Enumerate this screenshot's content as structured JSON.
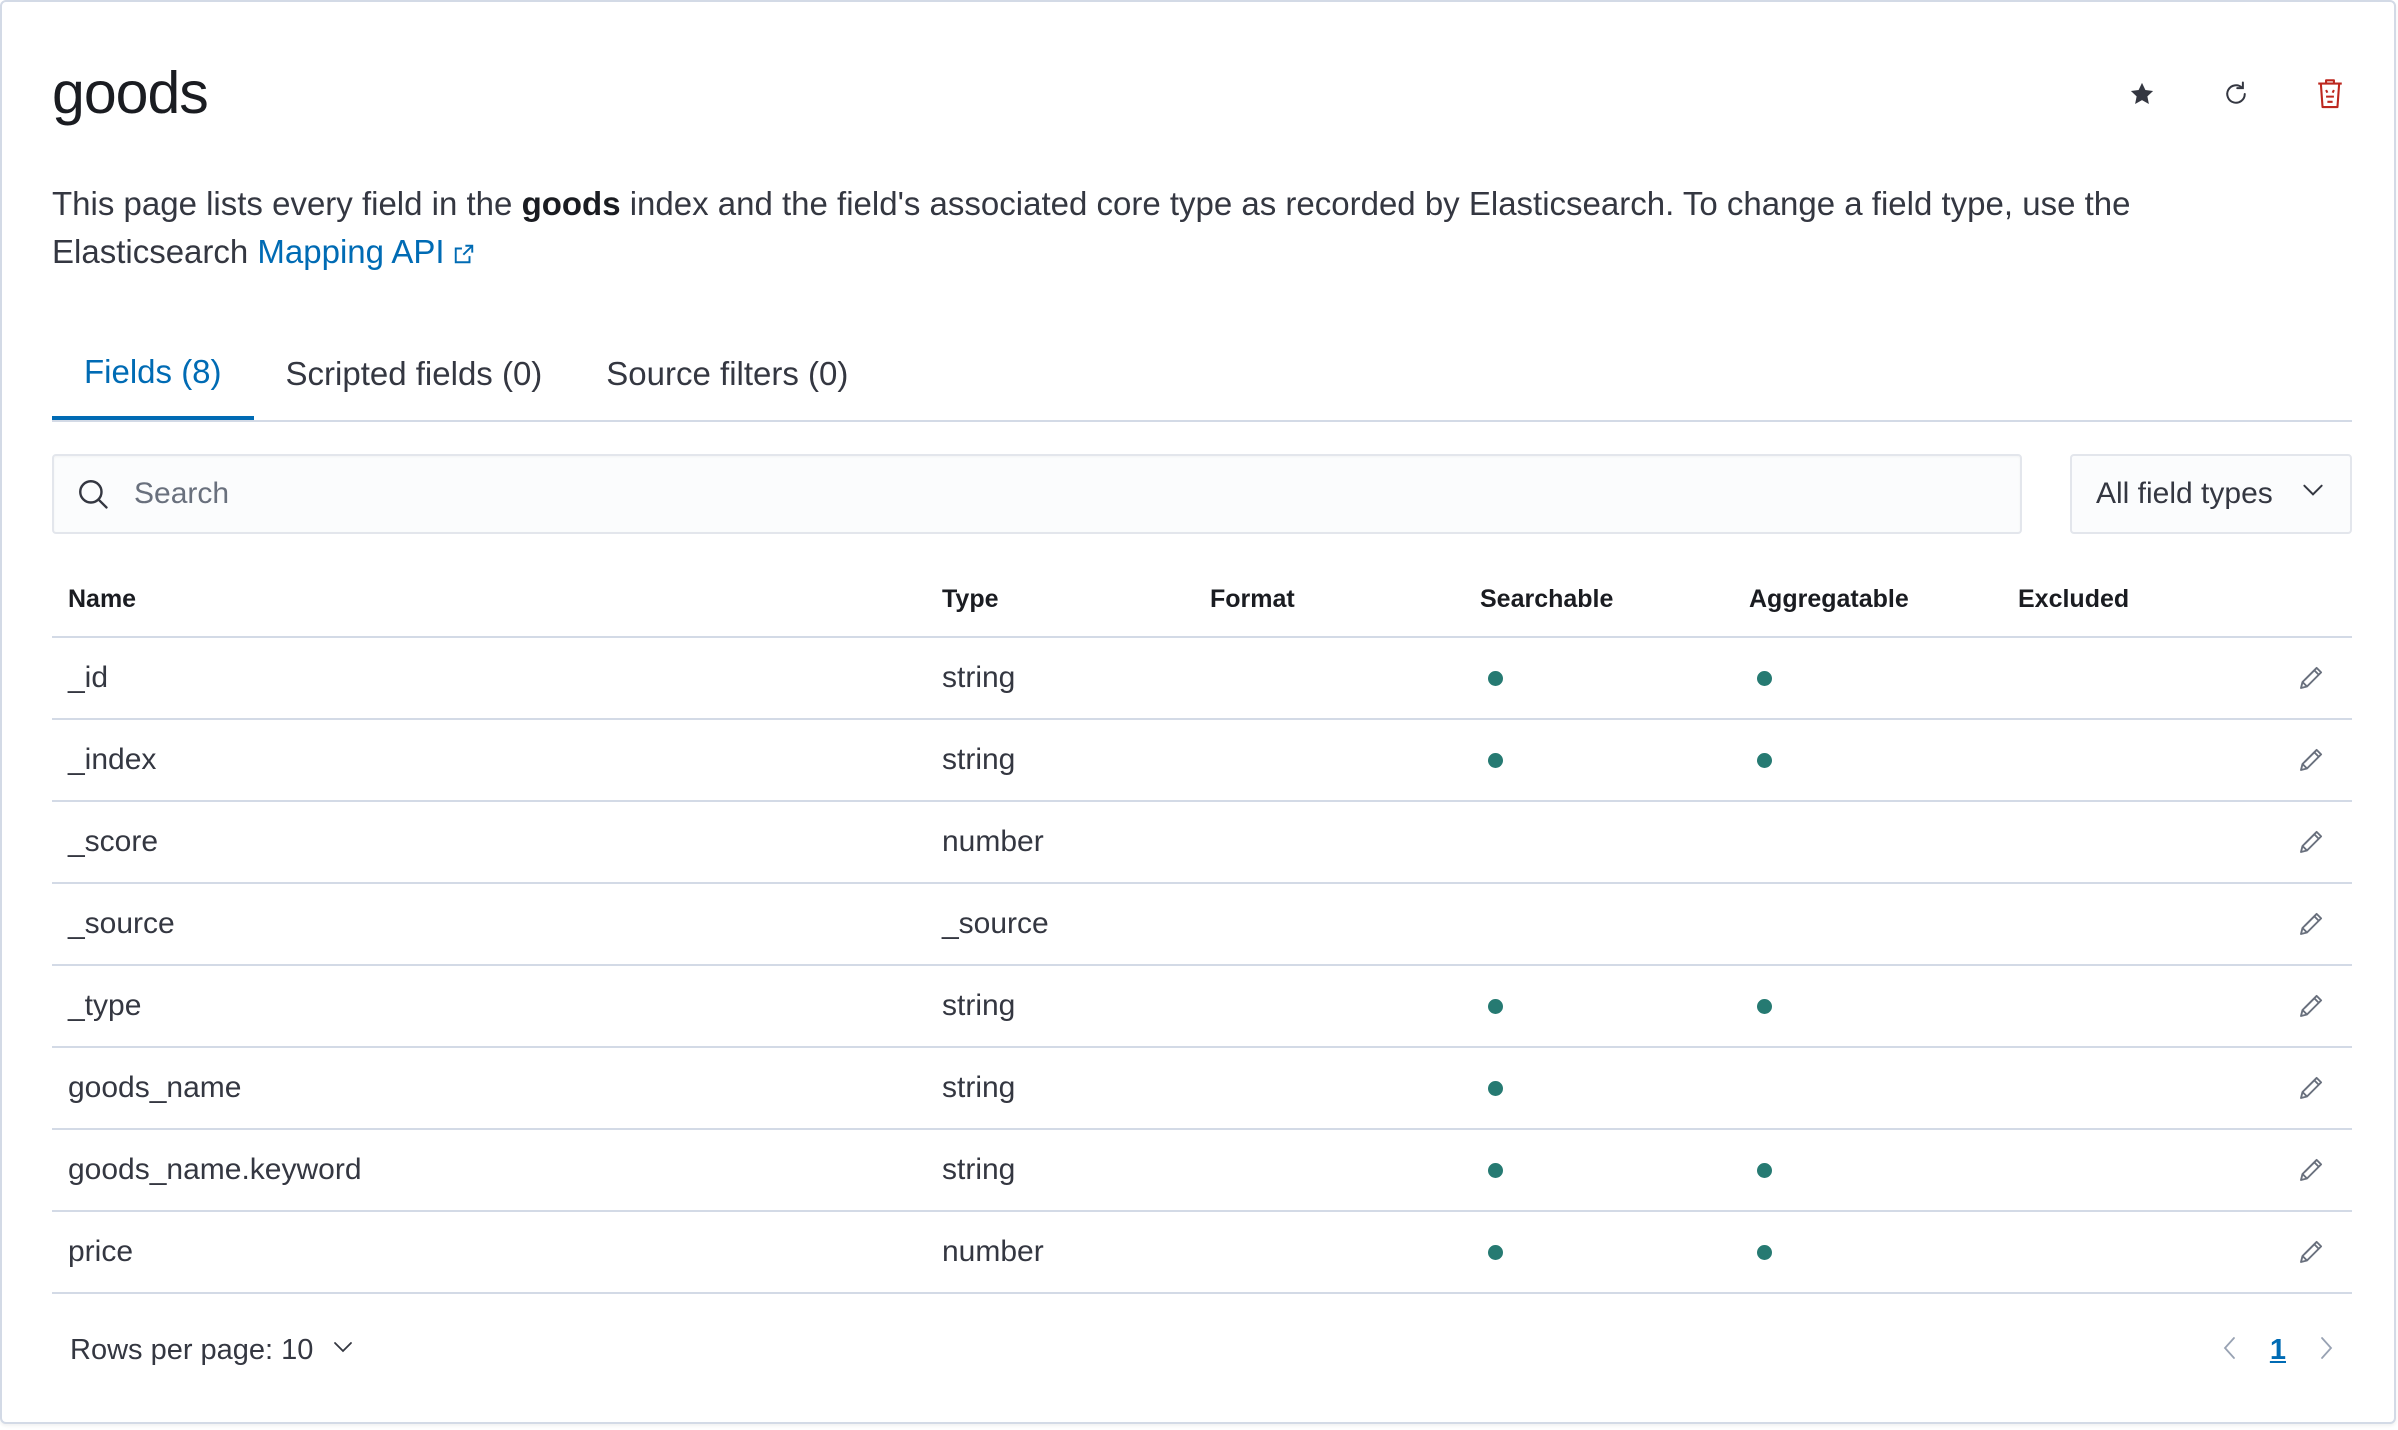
{
  "page": {
    "title": "goods",
    "description_before": "This page lists every field in the ",
    "description_bold": "goods",
    "description_after": " index and the field's associated core type as recorded by Elasticsearch. To change a field type, use the Elasticsearch ",
    "mapping_link": "Mapping API"
  },
  "tabs": [
    {
      "label": "Fields (8)",
      "active": true
    },
    {
      "label": "Scripted fields (0)",
      "active": false
    },
    {
      "label": "Source filters (0)",
      "active": false
    }
  ],
  "search": {
    "placeholder": "Search",
    "value": ""
  },
  "filter": {
    "label": "All field types"
  },
  "table": {
    "columns": {
      "name": "Name",
      "type": "Type",
      "format": "Format",
      "searchable": "Searchable",
      "aggregatable": "Aggregatable",
      "excluded": "Excluded"
    },
    "rows": [
      {
        "name": "_id",
        "type": "string",
        "format": "",
        "searchable": true,
        "aggregatable": true,
        "excluded": false
      },
      {
        "name": "_index",
        "type": "string",
        "format": "",
        "searchable": true,
        "aggregatable": true,
        "excluded": false
      },
      {
        "name": "_score",
        "type": "number",
        "format": "",
        "searchable": false,
        "aggregatable": false,
        "excluded": false
      },
      {
        "name": "_source",
        "type": "_source",
        "format": "",
        "searchable": false,
        "aggregatable": false,
        "excluded": false
      },
      {
        "name": "_type",
        "type": "string",
        "format": "",
        "searchable": true,
        "aggregatable": true,
        "excluded": false
      },
      {
        "name": "goods_name",
        "type": "string",
        "format": "",
        "searchable": true,
        "aggregatable": false,
        "excluded": false
      },
      {
        "name": "goods_name.keyword",
        "type": "string",
        "format": "",
        "searchable": true,
        "aggregatable": true,
        "excluded": false
      },
      {
        "name": "price",
        "type": "number",
        "format": "",
        "searchable": true,
        "aggregatable": true,
        "excluded": false
      }
    ]
  },
  "pagination": {
    "rows_per_page": "Rows per page: 10",
    "current_page": "1"
  },
  "colors": {
    "accent": "#006bb4",
    "dot": "#267a72",
    "danger": "#bd271e",
    "border": "#d3dae6"
  },
  "icons": {
    "favorite": "star-icon",
    "refresh": "refresh-icon",
    "delete": "trash-icon",
    "search": "search-icon",
    "edit": "pencil-icon",
    "external": "external-link-icon"
  }
}
